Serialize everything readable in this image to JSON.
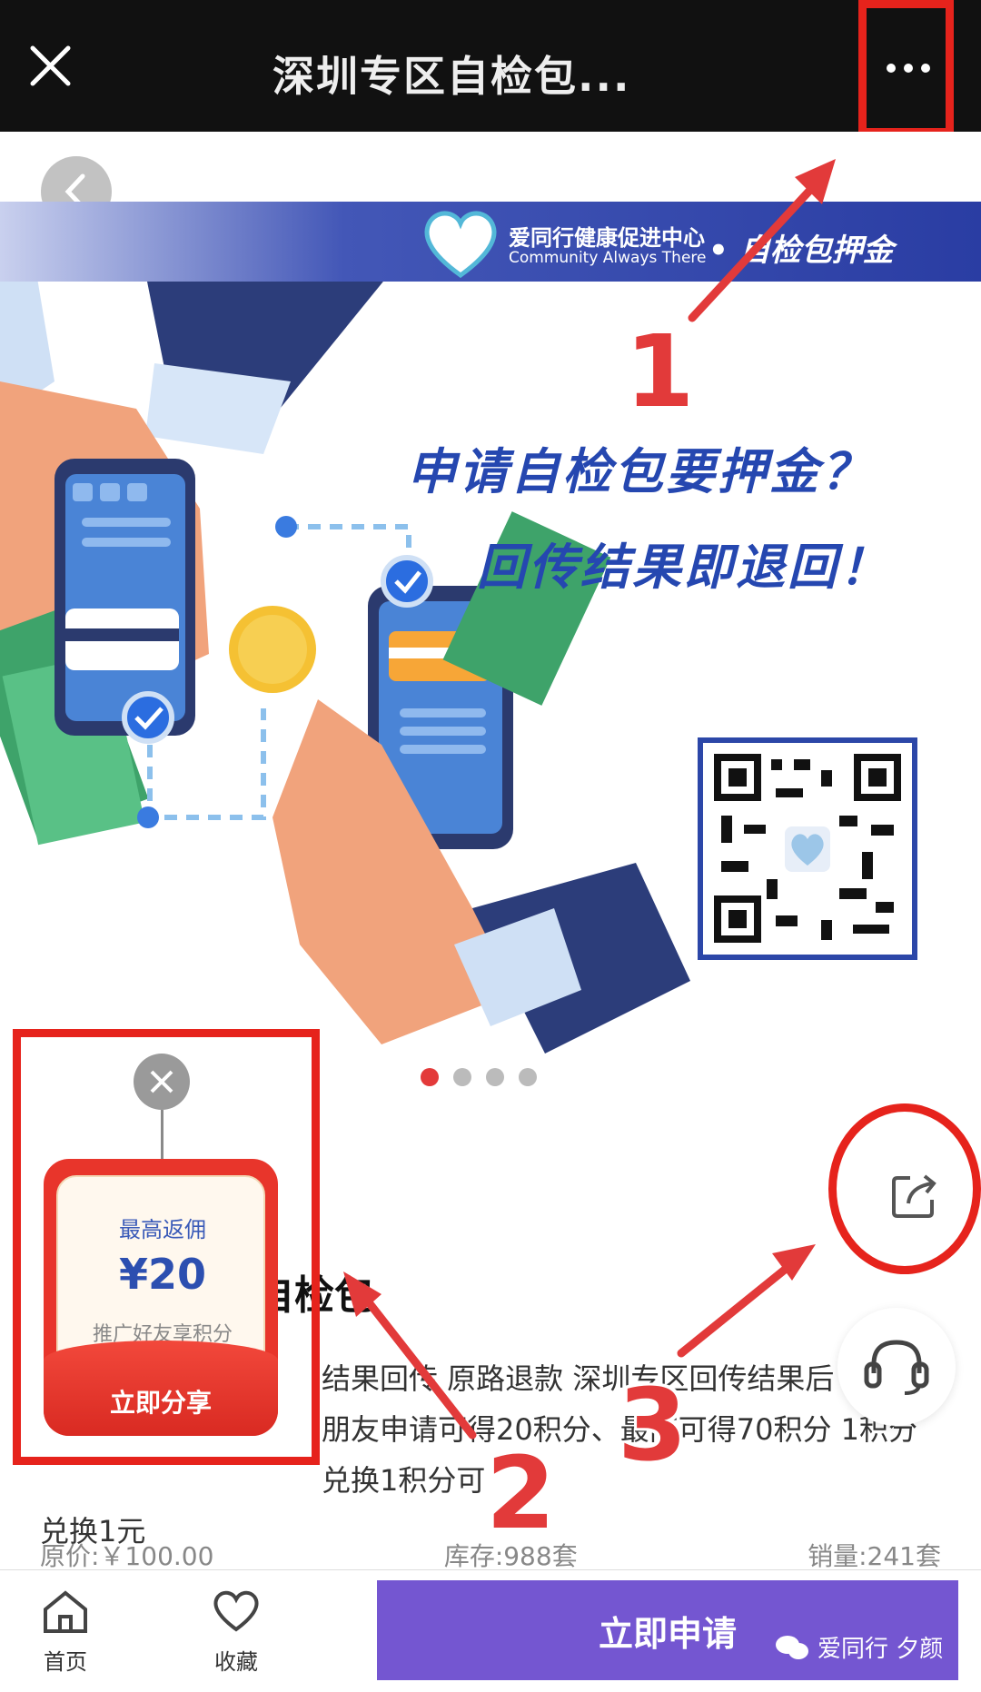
{
  "topbar": {
    "title": "深圳专区自检包..."
  },
  "banner": {
    "brand_name": "爱同行健康促进中心",
    "brand_sub": "Community Always There",
    "brand_tag": "• 自检包押金",
    "headline1": "申请自检包要押金？",
    "headline2": "回传结果即退回！",
    "dots_count": 4,
    "active_dot": 1
  },
  "annotations": {
    "n1": "1",
    "n2": "2",
    "n3": "3"
  },
  "popup": {
    "top_label": "最高返佣",
    "amount": "¥20",
    "sub_label": "推广好友享积分",
    "share_label": "立即分享"
  },
  "product": {
    "title": "自检包",
    "desc_line1": "结果回传 原路退款 深圳专区回传结果后",
    "desc_line2": "朋友申请可得20积分、最高可得70积分 1积分兑换1积分可",
    "desc_line3": "兑换1元",
    "original_price": "原价:￥100.00",
    "stock": "库存:988套",
    "sales": "销量:241套"
  },
  "bottombar": {
    "home_label": "首页",
    "fav_label": "收藏",
    "apply_label": "立即申请",
    "watermark": "爱同行 夕颜"
  },
  "colors": {
    "accent": "#7456d1",
    "annotation": "#e6231c",
    "brand_blue": "#2547b0"
  }
}
